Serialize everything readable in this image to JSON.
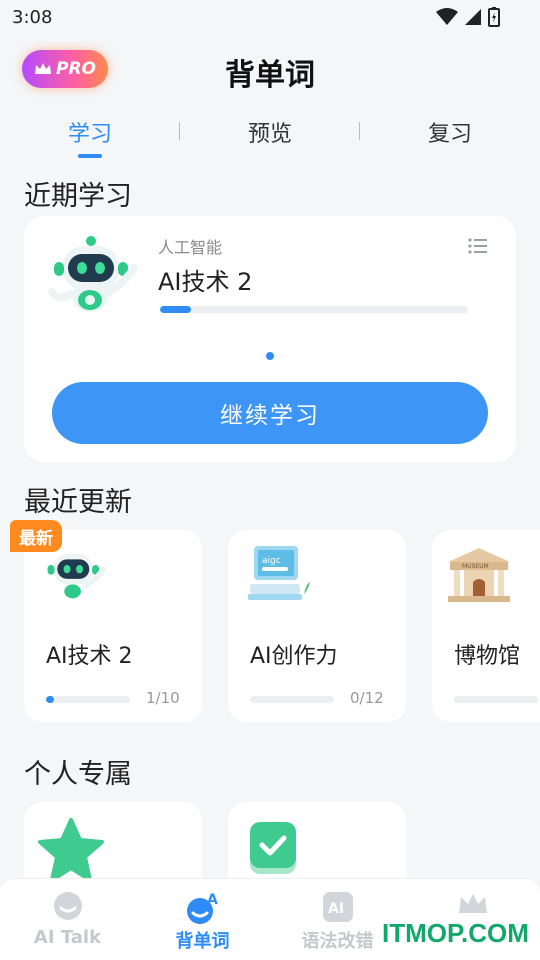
{
  "status_bar": {
    "time": "3:08"
  },
  "header": {
    "pro_label": "PRO",
    "title": "背单词"
  },
  "tabs": [
    {
      "label": "学习",
      "active": true
    },
    {
      "label": "预览",
      "active": false
    },
    {
      "label": "复习",
      "active": false
    }
  ],
  "recent_study": {
    "section_title": "近期学习",
    "category": "人工智能",
    "name": "AI技术 2",
    "progress": 0.1,
    "button_label": "继续学习"
  },
  "recent_updates": {
    "section_title": "最近更新",
    "new_badge": "最新",
    "cards": [
      {
        "title": "AI技术 2",
        "count": "1/10",
        "progress": 0.1,
        "image_icon": "robot-icon"
      },
      {
        "title": "AI创作力",
        "count": "0/12",
        "progress": 0,
        "image_icon": "aigc-computer-icon"
      },
      {
        "title": "博物馆",
        "count": "",
        "progress": 0,
        "image_icon": "museum-icon"
      }
    ]
  },
  "personal": {
    "section_title": "个人专属"
  },
  "bottom_nav": [
    {
      "label": "AI Talk",
      "icon": "chat-bubble-icon",
      "active": false
    },
    {
      "label": "背单词",
      "icon": "words-icon",
      "active": true
    },
    {
      "label": "语法改错",
      "icon": "ai-grammar-icon",
      "active": false
    },
    {
      "label": "",
      "icon": "crown-icon",
      "active": false
    }
  ],
  "watermark": "ITMOP.COM",
  "colors": {
    "accent": "#2f8cf4",
    "badge": "#ff8a1f",
    "pro_gradient": [
      "#b44bff",
      "#ff5fa2",
      "#ff8a4c"
    ]
  }
}
